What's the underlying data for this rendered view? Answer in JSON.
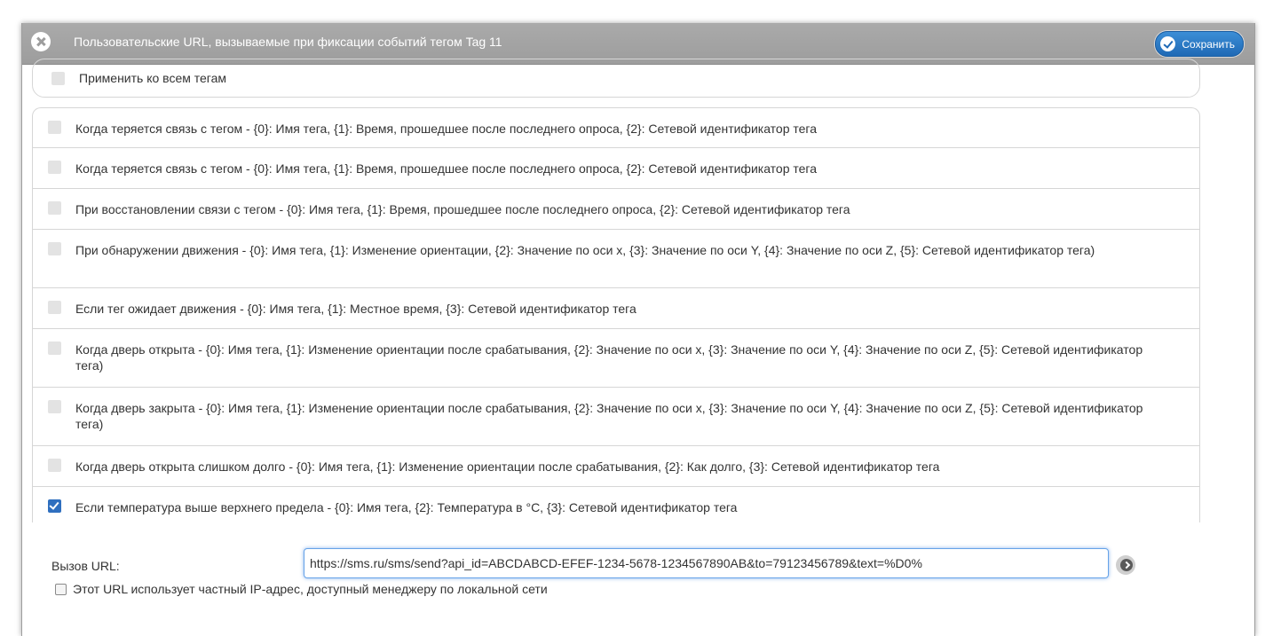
{
  "dialog": {
    "title": "Пользовательские URL, вызываемые при фиксации событий тегом Tag 11",
    "save_label": "Сохранить",
    "close_icon": "close-circle-icon",
    "save_icon": "check-circle-icon"
  },
  "apply_all": {
    "label": "Применить ко всем тегам",
    "checked": false
  },
  "events": [
    {
      "label": "Когда теряется связь с тегом - {0}: Имя тега, {1}: Время, прошедшее после последнего опроса, {2}: Сетевой идентификатор тега",
      "checked": false
    },
    {
      "label": "Когда теряется связь с тегом - {0}: Имя тега, {1}: Время, прошедшее после последнего опроса, {2}: Сетевой идентификатор тега",
      "checked": false
    },
    {
      "label": "При восстановлении связи с тегом - {0}: Имя тега, {1}: Время, прошедшее после последнего опроса, {2}: Сетевой идентификатор тега",
      "checked": false
    },
    {
      "label": "При обнаружении движения - {0}: Имя тега, {1}: Изменение ориентации, {2}: Значение по оси x, {3}: Значение по оси Y, {4}: Значение по оси Z, {5}: Сетевой идентификатор тега)",
      "checked": false
    },
    {
      "label": "Если тег ожидает движения - {0}: Имя тега, {1}: Местное время, {3}: Сетевой идентификатор тега",
      "checked": false
    },
    {
      "label": "Когда дверь открыта - {0}: Имя тега, {1}: Изменение ориентации после срабатывания, {2}: Значение по оси x, {3}: Значение по оси Y, {4}: Значение по оси Z, {5}: Сетевой идентификатор тега)",
      "checked": false
    },
    {
      "label": "Когда дверь закрыта - {0}: Имя тега, {1}: Изменение ориентации после срабатывания, {2}: Значение по оси x, {3}: Значение по оси Y, {4}: Значение по оси Z, {5}: Сетевой идентификатор тега)",
      "checked": false
    },
    {
      "label": "Когда дверь открыта слишком долго - {0}: Имя тега, {1}: Изменение ориентации после срабатывания, {2}: Как долго, {3}: Сетевой идентификатор тега",
      "checked": false
    },
    {
      "label": "Если температура выше верхнего предела - {0}: Имя тега, {2}: Температура в °C, {3}: Сетевой идентификатор тега",
      "checked": true
    }
  ],
  "url": {
    "label": "Вызов URL:",
    "value": "https://sms.ru/sms/send?api_id=ABCDABCD-EFEF-1234-5678-1234567890AB&to=79123456789&text=%D0%",
    "go_icon": "arrow-right-circle-icon"
  },
  "private_ip": {
    "label": "Этот URL использует частный IP-адрес, доступный менеджеру по локальной сети",
    "checked": false
  }
}
